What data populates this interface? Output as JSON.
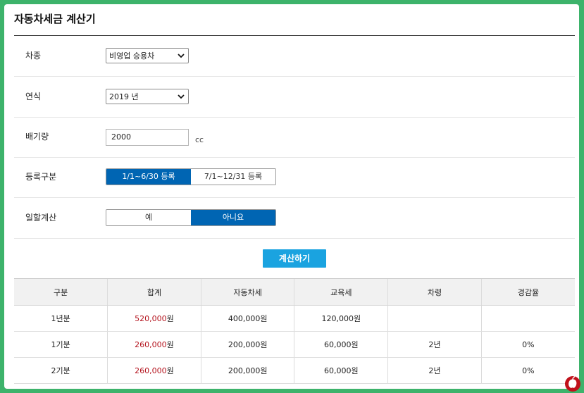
{
  "title": "자동차세금 계산기",
  "form": {
    "vehicle_type": {
      "label": "차종",
      "value": "비영업 승용차"
    },
    "model_year": {
      "label": "연식",
      "value": "2019 년"
    },
    "displacement": {
      "label": "배기량",
      "value": "2000",
      "unit": "cc"
    },
    "registration": {
      "label": "등록구분",
      "options": [
        "1/1~6/30 등록",
        "7/1~12/31 등록"
      ],
      "selected": 0
    },
    "prorate": {
      "label": "일할계산",
      "options": [
        "예",
        "아니요"
      ],
      "selected": 1
    }
  },
  "calculate_label": "계산하기",
  "table": {
    "headers": [
      "구분",
      "합계",
      "자동차세",
      "교육세",
      "차령",
      "경감율"
    ],
    "won": "원",
    "rows": [
      {
        "type": "1년분",
        "total": "520,000",
        "car_tax": "400,000원",
        "edu_tax": "120,000원",
        "age": "",
        "reduction": ""
      },
      {
        "type": "1기분",
        "total": "260,000",
        "car_tax": "200,000원",
        "edu_tax": "60,000원",
        "age": "2년",
        "reduction": "0%"
      },
      {
        "type": "2기분",
        "total": "260,000",
        "car_tax": "200,000원",
        "edu_tax": "60,000원",
        "age": "2년",
        "reduction": "0%"
      }
    ]
  },
  "colors": {
    "background": "#3db36b",
    "active_toggle": "#0065b3",
    "button": "#1aa3e0",
    "total_text": "#b3121c"
  },
  "icons": {
    "select_arrow": "chevron-down-icon",
    "corner_logo": "apple-logo-icon"
  }
}
